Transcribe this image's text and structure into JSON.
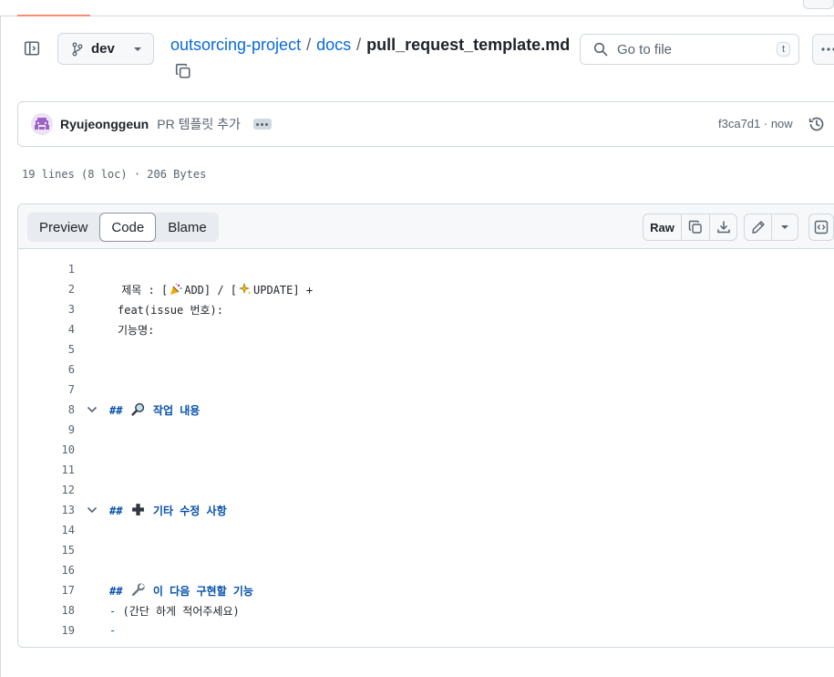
{
  "repo": {
    "branch": "dev",
    "crumbs": {
      "repo": "outsorcing-project",
      "sep1": "/",
      "folder": "docs",
      "sep2": "/",
      "file": "pull_request_template.md"
    }
  },
  "search": {
    "placeholder": "Go to file",
    "shortcut": "t"
  },
  "commit": {
    "author": "Ryujeonggeun",
    "message": "PR 템플릿 추가",
    "meta": "f3ca7d1 · now"
  },
  "file": {
    "info": "19 lines (8 loc) · 206 Bytes"
  },
  "viewer": {
    "tabs": [
      "Preview",
      "Code",
      "Blame"
    ],
    "active_tab": "Code",
    "raw_label": "Raw"
  },
  "code_lines": [
    {
      "n": "1",
      "text": ""
    },
    {
      "n": "2",
      "t1": " 제목 : [",
      "t2": "ADD] / [",
      "t3": "UPDATE] +"
    },
    {
      "n": "3",
      "text": "feat(issue 번호):"
    },
    {
      "n": "4",
      "text": "기능명:"
    },
    {
      "n": "5",
      "text": ""
    },
    {
      "n": "6",
      "text": ""
    },
    {
      "n": "7",
      "text": ""
    },
    {
      "n": "8",
      "hash": "##",
      "text": "작업 내용",
      "icon": "magnifier"
    },
    {
      "n": "9",
      "text": ""
    },
    {
      "n": "10",
      "text": ""
    },
    {
      "n": "11",
      "text": ""
    },
    {
      "n": "12",
      "text": ""
    },
    {
      "n": "13",
      "hash": "##",
      "text": "기타 수정 사항",
      "icon": "plus"
    },
    {
      "n": "14",
      "text": ""
    },
    {
      "n": "15",
      "text": ""
    },
    {
      "n": "16",
      "text": ""
    },
    {
      "n": "17",
      "hash": "##",
      "text": "이 다음 구현할 기능",
      "icon": "wrench"
    },
    {
      "n": "18",
      "dash": "-",
      "text": "(간단 하게 적어주세요)"
    },
    {
      "n": "19",
      "dash": "-"
    }
  ]
}
